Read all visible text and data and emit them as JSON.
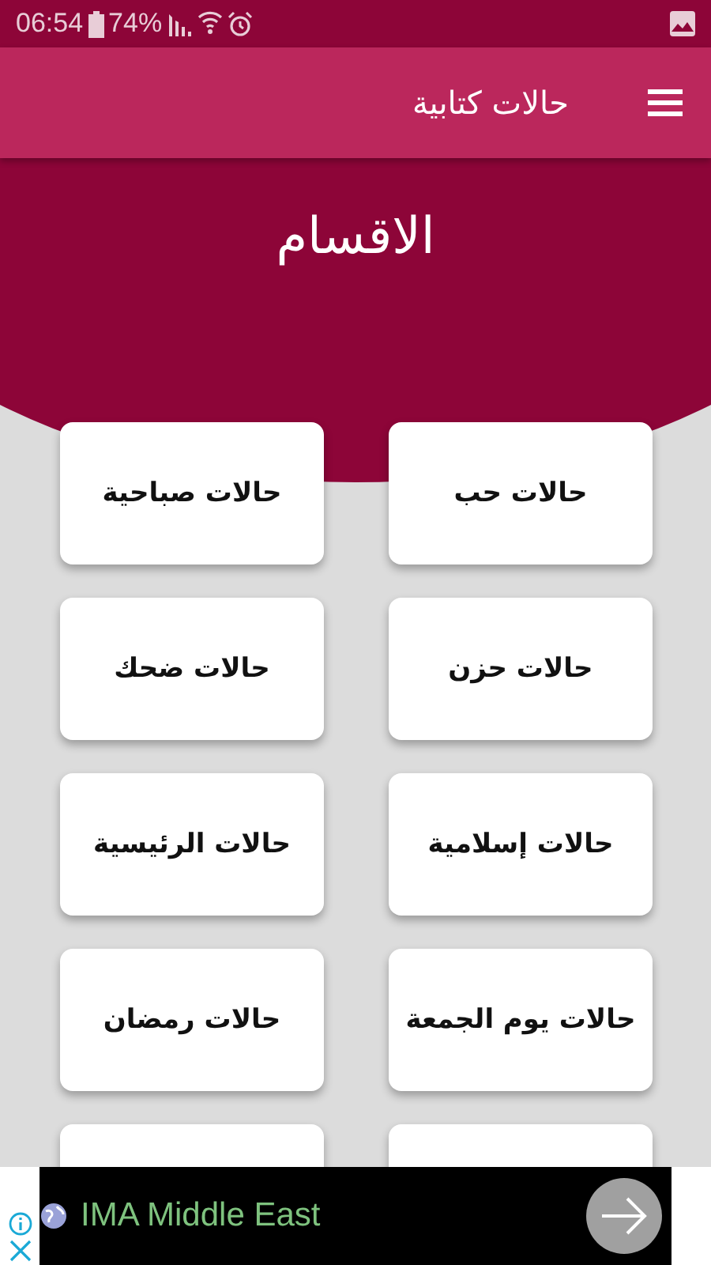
{
  "status_bar": {
    "time": "06:54",
    "battery": "74%"
  },
  "toolbar": {
    "title": "حالات كتابية"
  },
  "heading": "الاقسام",
  "categories": [
    {
      "label": "حالات حب"
    },
    {
      "label": "حالات صباحية"
    },
    {
      "label": "حالات حزن"
    },
    {
      "label": "حالات ضحك"
    },
    {
      "label": "حالات إسلامية"
    },
    {
      "label": "حالات الرئيسية"
    },
    {
      "label": "حالات يوم الجمعة"
    },
    {
      "label": "حالات رمضان"
    }
  ],
  "ad": {
    "text": "IMA Middle East"
  }
}
